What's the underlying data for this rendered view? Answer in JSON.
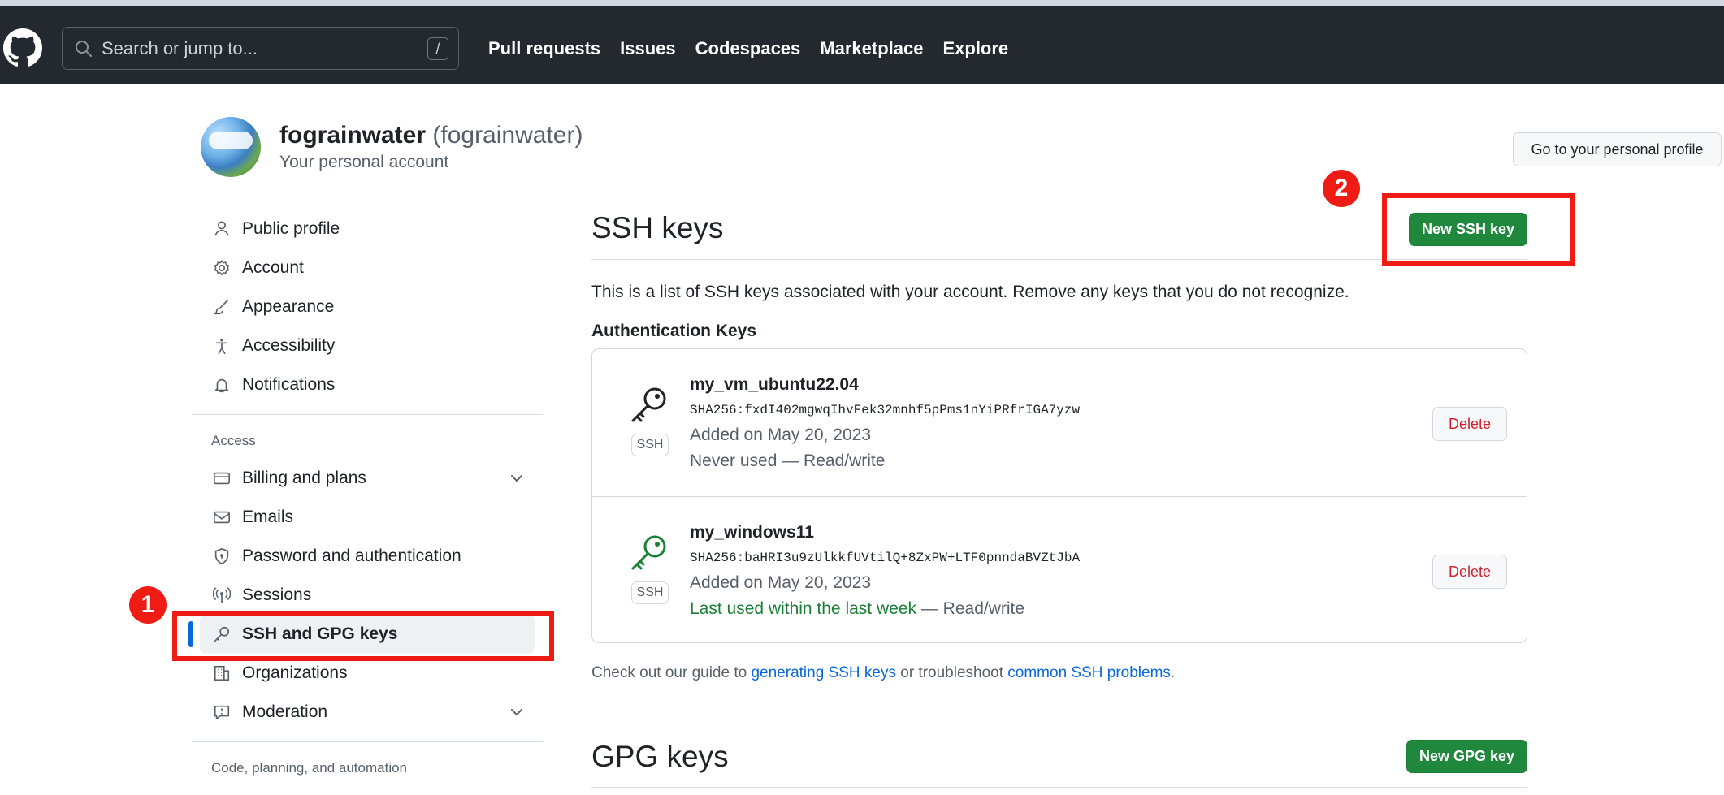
{
  "topbar": {
    "search_placeholder": "Search or jump to...",
    "search_shortcut": "/",
    "nav_links": [
      "Pull requests",
      "Issues",
      "Codespaces",
      "Marketplace",
      "Explore"
    ]
  },
  "header": {
    "display_name": "fograinwater",
    "handle": "(fograinwater)",
    "subtitle": "Your personal account",
    "profile_button": "Go to your personal profile"
  },
  "sidebar": {
    "group1": [
      {
        "label": "Public profile",
        "icon": "person-icon"
      },
      {
        "label": "Account",
        "icon": "gear-icon"
      },
      {
        "label": "Appearance",
        "icon": "paintbrush-icon"
      },
      {
        "label": "Accessibility",
        "icon": "accessibility-icon"
      },
      {
        "label": "Notifications",
        "icon": "bell-icon"
      }
    ],
    "access_heading": "Access",
    "access": [
      {
        "label": "Billing and plans",
        "icon": "credit-card-icon"
      },
      {
        "label": "Emails",
        "icon": "mail-icon"
      },
      {
        "label": "Password and authentication",
        "icon": "shield-lock-icon"
      },
      {
        "label": "Sessions",
        "icon": "broadcast-icon"
      },
      {
        "label": "SSH and GPG keys",
        "icon": "key-icon"
      },
      {
        "label": "Organizations",
        "icon": "organization-icon"
      },
      {
        "label": "Moderation",
        "icon": "report-icon"
      }
    ],
    "code_heading": "Code, planning, and automation"
  },
  "ssh": {
    "title": "SSH keys",
    "new_button": "New SSH key",
    "description": "This is a list of SSH keys associated with your account. Remove any keys that you do not recognize.",
    "auth_heading": "Authentication Keys",
    "keys": [
      {
        "name": "my_vm_ubuntu22.04",
        "fingerprint": "SHA256:fxdI402mgwqIhvFek32mnhf5pPms1nYiPRfrIGA7yzw",
        "added": "Added on May 20, 2023",
        "usage": "Never used",
        "usage_recent": "",
        "access": " — Read/write",
        "tag": "SSH",
        "delete": "Delete",
        "icon_color": "#1f2328"
      },
      {
        "name": "my_windows11",
        "fingerprint": "SHA256:baHRI3u9zUlkkfUVtilQ+8ZxPW+LTF0pnndaBVZtJbA",
        "added": "Added on May 20, 2023",
        "usage": "",
        "usage_recent": "Last used within the last week",
        "access": " — Read/write",
        "tag": "SSH",
        "delete": "Delete",
        "icon_color": "#1a7f37"
      }
    ],
    "guide_prefix": "Check out our guide to ",
    "guide_link1": "generating SSH keys",
    "guide_middle": " or troubleshoot ",
    "guide_link2": "common SSH problems",
    "guide_suffix": "."
  },
  "gpg": {
    "title": "GPG keys",
    "new_button": "New GPG key"
  },
  "annotations": {
    "step1": "1",
    "step2": "2"
  },
  "colors": {
    "accent": "#0969da",
    "primary_button": "#1f883d",
    "danger": "#cf222e",
    "annotation": "#ee1c14"
  }
}
